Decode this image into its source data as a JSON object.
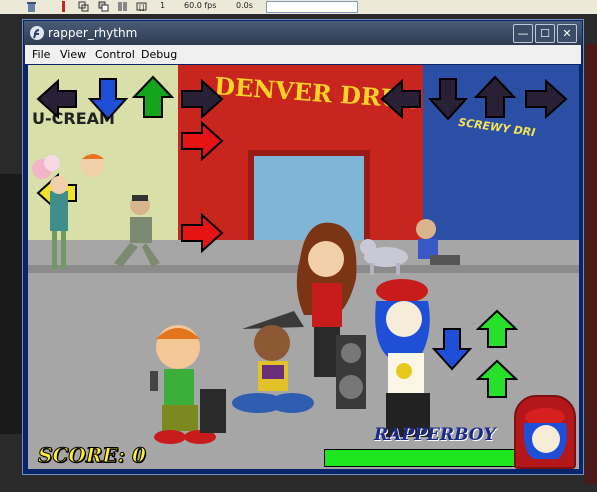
{
  "toolbar": {
    "frame": "1",
    "fps": "60.0 fps",
    "time": "0.0s"
  },
  "window": {
    "title": "rapper_rhythm",
    "minimize": "—",
    "maximize": "☐",
    "close": "✕"
  },
  "menu": {
    "items": [
      "File",
      "View",
      "Control",
      "Debug"
    ]
  },
  "scene": {
    "store_center": "DENVER DRUGS",
    "store_right": "SCREWY DRI",
    "store_left": "U-CREAM"
  },
  "hud": {
    "score_label": "SCORE: 0",
    "opponent_name": "RAPPERBOY",
    "health_fraction": 1.0
  },
  "colors": {
    "arrow_dark": "#2a2036",
    "arrow_blue": "#1f4fd6",
    "arrow_green": "#15a51c",
    "arrow_red": "#e41414",
    "arrow_yellow": "#f4e12a",
    "bright_green": "#27e02a"
  }
}
